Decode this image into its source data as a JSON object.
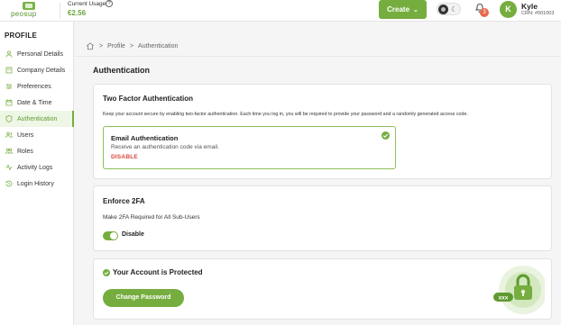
{
  "header": {
    "logo_text_a": "peo",
    "logo_text_b": "s",
    "logo_text_c": "up",
    "usage_label": "Current Usage",
    "usage_value": "€2.56",
    "create_label": "Create",
    "notification_count": "3",
    "avatar_initial": "K",
    "user_name": "Kyle",
    "user_crn": "CRN: #001003"
  },
  "sidebar": {
    "title": "PROFILE",
    "items": [
      {
        "label": "Personal Details",
        "icon": "user-icon"
      },
      {
        "label": "Company Details",
        "icon": "building-icon"
      },
      {
        "label": "Preferences",
        "icon": "sliders-icon"
      },
      {
        "label": "Date & Time",
        "icon": "calendar-icon"
      },
      {
        "label": "Authentication",
        "icon": "shield-icon"
      },
      {
        "label": "Users",
        "icon": "users-icon"
      },
      {
        "label": "Roles",
        "icon": "roles-icon"
      },
      {
        "label": "Activity Logs",
        "icon": "activity-icon"
      },
      {
        "label": "Login History",
        "icon": "history-icon"
      }
    ],
    "active_index": 4
  },
  "breadcrumb": {
    "items": [
      "Profile",
      "Authentication"
    ],
    "sep": ">"
  },
  "main": {
    "title": "Authentication",
    "two_factor": {
      "title": "Two Factor Authentication",
      "description": "Keep your account secure by enabling two-factor authentication. Each time you log in, you will be required to provide your password and a randomly generated access code.",
      "email": {
        "title": "Email Authentication",
        "description": "Receive an authentication code via email.",
        "action": "DISABLE"
      }
    },
    "enforce": {
      "title": "Enforce 2FA",
      "description": "Make 2FA Required for All Sub-Users",
      "toggle_label": "Disable",
      "toggle_on": true
    },
    "protected": {
      "title": "Your Account is Protected",
      "button": "Change Password",
      "lock_code": "xxx"
    }
  },
  "colors": {
    "accent": "#76ad3f",
    "danger": "#d9483b",
    "badge": "#e66a4a"
  }
}
